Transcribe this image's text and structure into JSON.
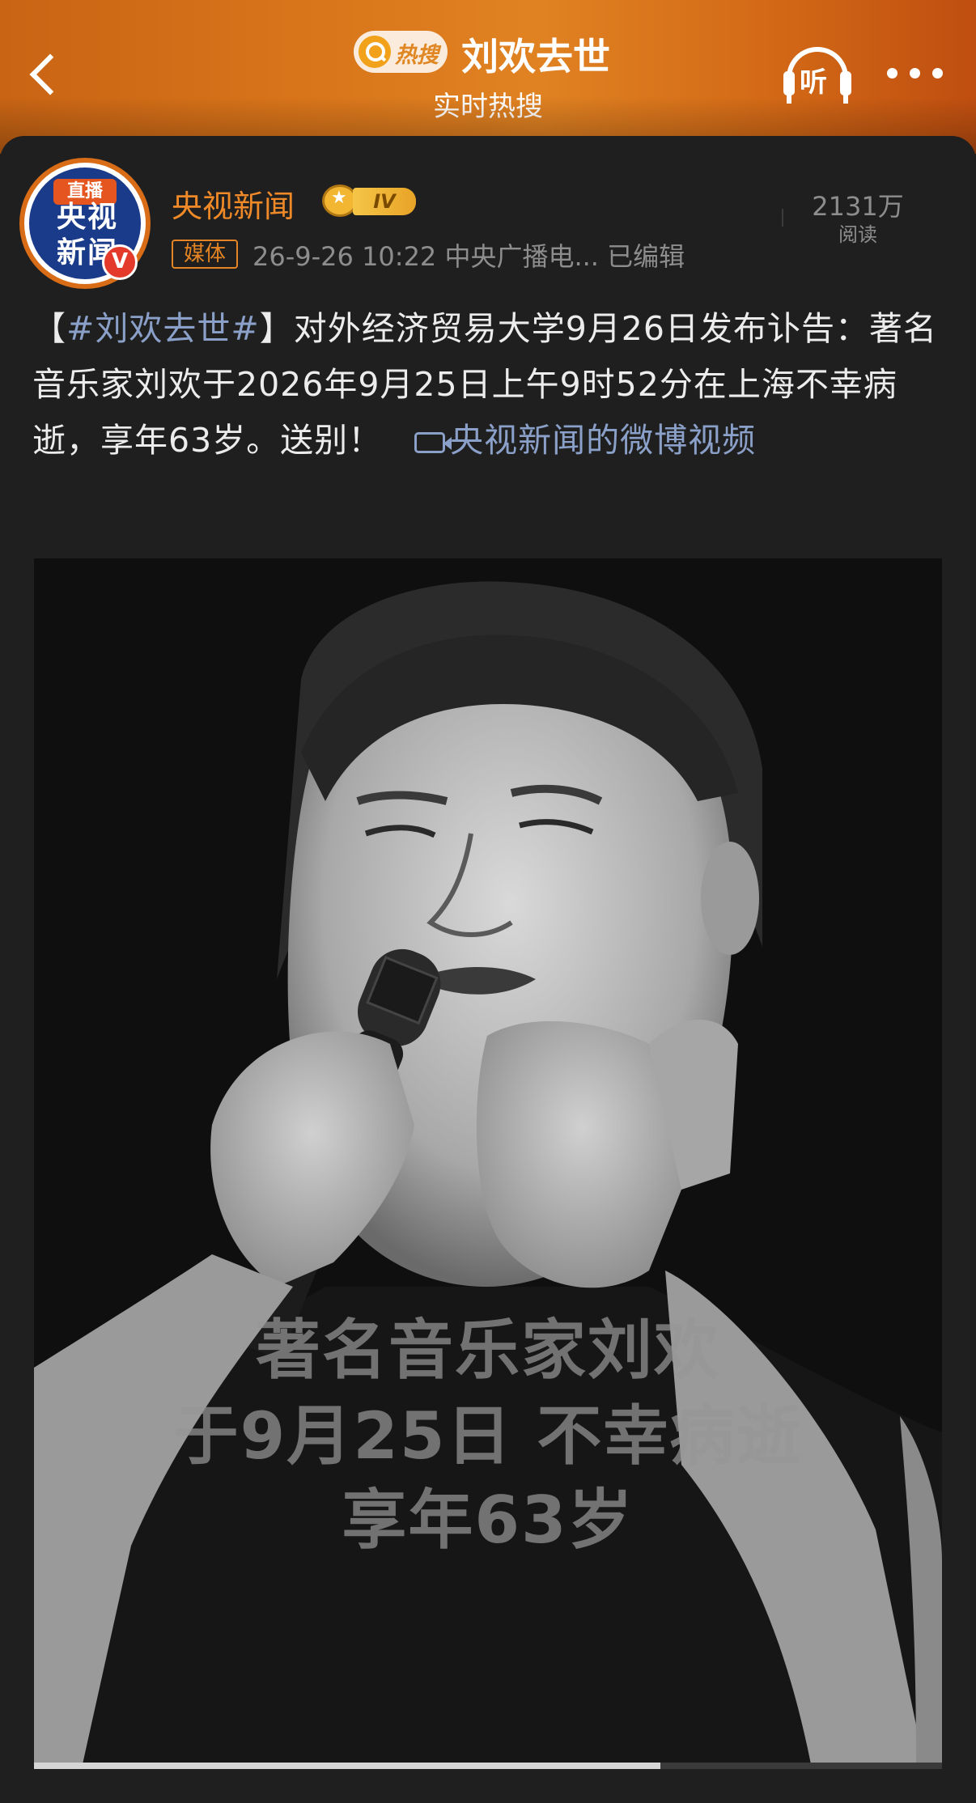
{
  "header": {
    "hot_label": "热搜",
    "title": "刘欢去世",
    "subtitle": "实时热搜",
    "listen_label": "听"
  },
  "post": {
    "avatar_live_label": "直播",
    "avatar_logo_line1": "央视",
    "avatar_logo_line2": "新闻",
    "verify_mark": "V",
    "username": "央视新闻",
    "level": "IV",
    "media_tag": "媒体",
    "meta": "26-9-26 10:22  中央广播电...  已编辑",
    "reads_count": "2131万",
    "reads_label": "阅读",
    "text_open_bracket": "【",
    "hashtag": "#刘欢去世#",
    "text_close_bracket": "】",
    "text_body": "对外经济贸易大学9月26日发布讣告：著名音乐家刘欢于2026年9月25日上午9时52分在上海不幸病逝，享年63岁。送别！",
    "video_link": "央视新闻的微博视频"
  },
  "video": {
    "caption_line1": "著名音乐家刘欢",
    "caption_line2": "于9月25日 不幸病逝",
    "caption_line3": "享年63岁",
    "progress": 0.69
  },
  "colors": {
    "accent_orange": "#f08a28",
    "link_blue": "#8aa0c8",
    "background": "#1f1f1f"
  }
}
